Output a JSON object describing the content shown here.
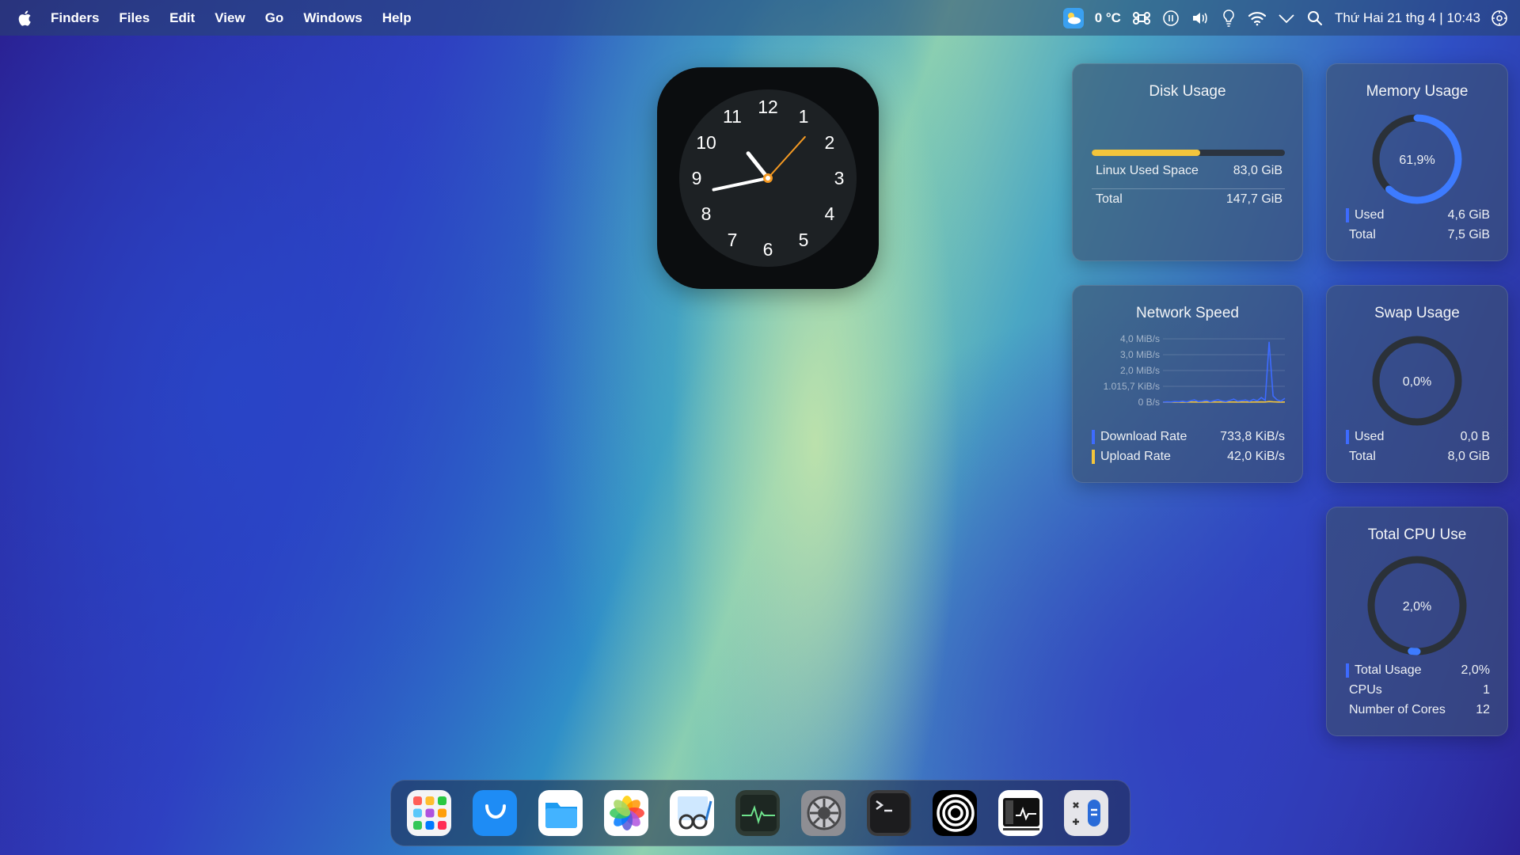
{
  "menubar": {
    "items": [
      "Finders",
      "Files",
      "Edit",
      "View",
      "Go",
      "Windows",
      "Help"
    ],
    "temperature": "0 °C",
    "datetime": "Thứ Hai 21 thg 4 | 10:43"
  },
  "clock": {
    "numbers": [
      "12",
      "1",
      "2",
      "3",
      "4",
      "5",
      "6",
      "7",
      "8",
      "9",
      "10",
      "11"
    ],
    "hour": 10,
    "minute": 43,
    "second": 7
  },
  "disk": {
    "title": "Disk Usage",
    "used_fraction": 0.562,
    "used_label": "Linux Used Space",
    "used_value": "83,0 GiB",
    "total_label": "Total",
    "total_value": "147,7 GiB",
    "bar_color": "#f3c53c"
  },
  "memory": {
    "title": "Memory Usage",
    "percent_text": "61,9%",
    "fraction": 0.619,
    "used_label": "Used",
    "used_value": "4,6 GiB",
    "total_label": "Total",
    "total_value": "7,5 GiB",
    "color": "#3d7bff"
  },
  "network": {
    "title": "Network Speed",
    "download_label": "Download Rate",
    "download_value": "733,8 KiB/s",
    "upload_label": "Upload Rate",
    "upload_value": "42,0 KiB/s",
    "download_color": "#3d6bff",
    "upload_color": "#f3c53c"
  },
  "swap": {
    "title": "Swap Usage",
    "percent_text": "0,0%",
    "fraction": 0.0,
    "used_label": "Used",
    "used_value": "0,0 B",
    "total_label": "Total",
    "total_value": "8,0 GiB"
  },
  "cpu": {
    "title": "Total CPU Use",
    "percent_text": "2,0%",
    "fraction": 0.02,
    "rows": [
      {
        "label": "Total Usage",
        "value": "2,0%"
      },
      {
        "label": "CPUs",
        "value": "1"
      },
      {
        "label": "Number of Cores",
        "value": "12"
      }
    ]
  },
  "chart_data": {
    "type": "line",
    "title": "",
    "yticks": [
      "4,0 MiB/s",
      "3,0 MiB/s",
      "2,0 MiB/s",
      "1.015,7 KiB/s",
      "0 B/s"
    ],
    "ylim": [
      0,
      4096
    ],
    "grid": true,
    "series": [
      {
        "name": "Download Rate",
        "color": "#3d6bff",
        "values": [
          0,
          20,
          10,
          40,
          30,
          60,
          20,
          80,
          150,
          40,
          60,
          120,
          30,
          90,
          160,
          70,
          40,
          110,
          200,
          60,
          90,
          140,
          50,
          180,
          80,
          300,
          120,
          3900,
          400,
          150,
          60,
          250
        ]
      },
      {
        "name": "Upload Rate",
        "color": "#f3c53c",
        "values": [
          0,
          5,
          3,
          8,
          4,
          10,
          6,
          12,
          8,
          5,
          7,
          9,
          6,
          10,
          12,
          8,
          5,
          9,
          11,
          7,
          8,
          10,
          6,
          12,
          9,
          15,
          10,
          40,
          20,
          10,
          6,
          12
        ]
      }
    ]
  },
  "dock": {
    "apps": [
      "launchpad-icon",
      "app-store-icon",
      "files-icon",
      "photos-icon",
      "preview-icon",
      "activity-monitor-icon",
      "system-settings-icon",
      "terminal-icon",
      "spiral-app-icon",
      "system-monitor-icon",
      "calculator-icon"
    ]
  }
}
